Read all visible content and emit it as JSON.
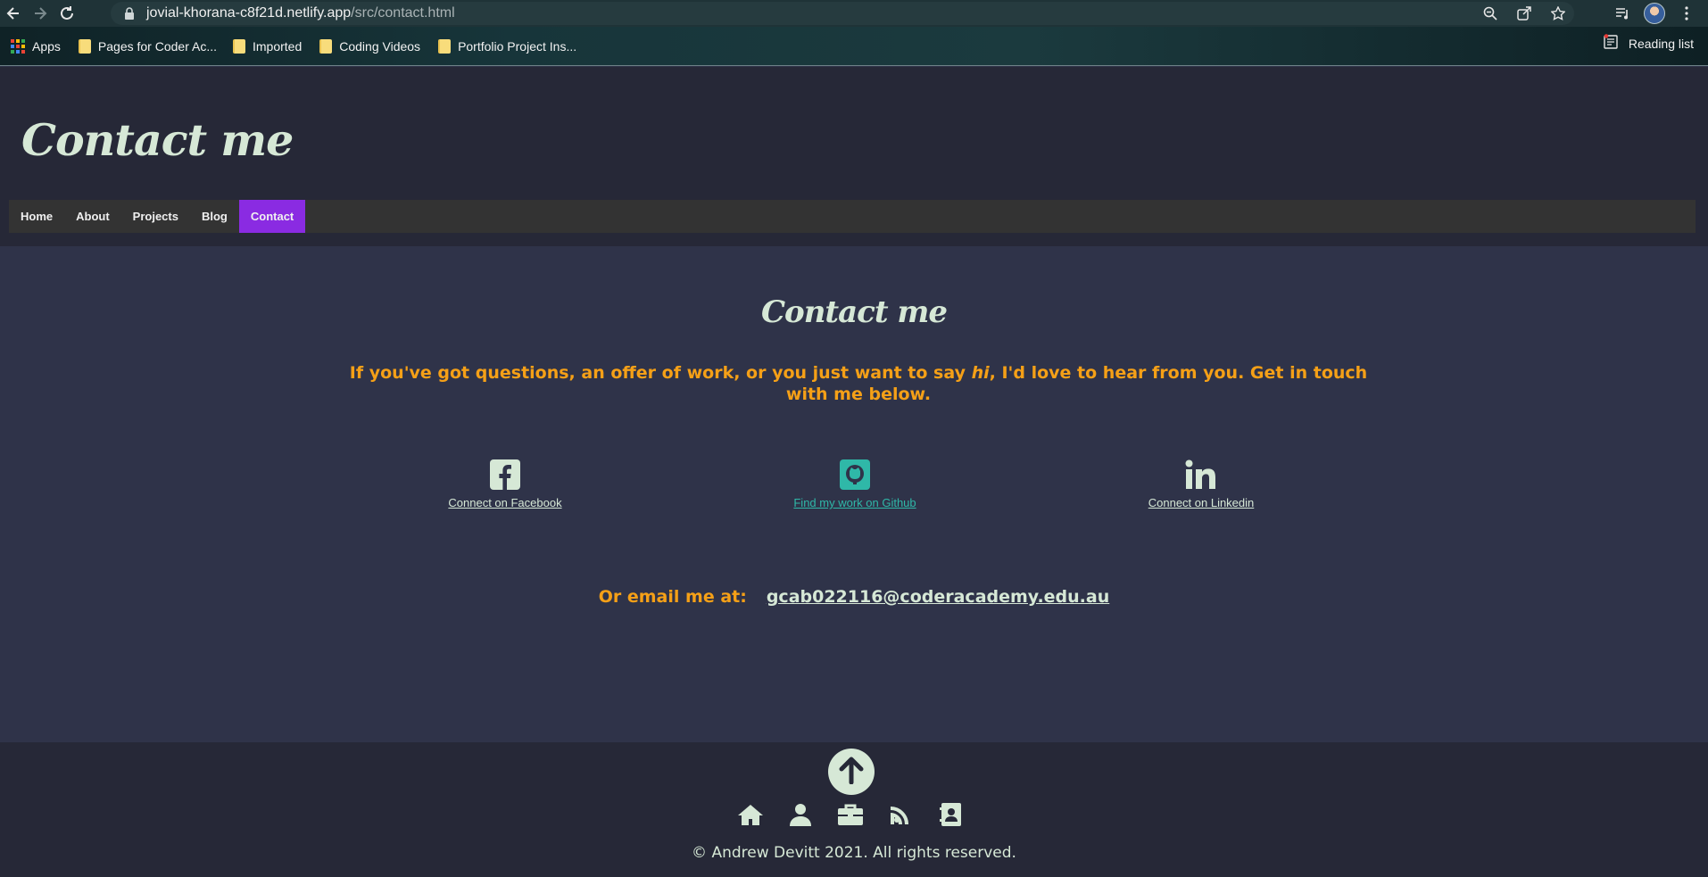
{
  "browser": {
    "url_host": "jovial-khorana-c8f21d.netlify.app",
    "url_path": "/src/contact.html",
    "bookmarks": [
      {
        "label": "Apps",
        "icon": "apps-grid-icon"
      },
      {
        "label": "Pages for Coder Ac...",
        "icon": "folder-icon"
      },
      {
        "label": "Imported",
        "icon": "folder-icon"
      },
      {
        "label": "Coding Videos",
        "icon": "folder-icon"
      },
      {
        "label": "Portfolio Project Ins...",
        "icon": "folder-icon"
      }
    ],
    "reading_list_label": "Reading list"
  },
  "header": {
    "title": "Contact me",
    "nav": [
      {
        "label": "Home",
        "active": false
      },
      {
        "label": "About",
        "active": false
      },
      {
        "label": "Projects",
        "active": false
      },
      {
        "label": "Blog",
        "active": false
      },
      {
        "label": "Contact",
        "active": true
      }
    ],
    "active_color": "#8a2be2"
  },
  "main": {
    "title": "Contact me",
    "intro_before": "If you've got questions, an offer of work, or you just want to say ",
    "intro_emph": "hi",
    "intro_after": ", I'd love to hear from you. Get in touch with me below.",
    "social": [
      {
        "label": "Connect on Facebook",
        "icon": "facebook-icon"
      },
      {
        "label": "Find my work on Github",
        "icon": "github-icon"
      },
      {
        "label": "Connect on Linkedin",
        "icon": "linkedin-icon"
      }
    ],
    "email_label": "Or email me at:",
    "email": "gcab022116@coderacademy.edu.au"
  },
  "footer": {
    "copyright": "© Andrew Devitt 2021. All rights reserved.",
    "icons": [
      "home-icon",
      "user-icon",
      "briefcase-icon",
      "blog-icon",
      "contact-book-icon"
    ]
  },
  "colors": {
    "accent_orange": "#f5a017",
    "text_light": "#d6e8d6",
    "github_teal": "#2fb8a8",
    "page_bg": "#2f3349",
    "header_bg": "#262837"
  }
}
